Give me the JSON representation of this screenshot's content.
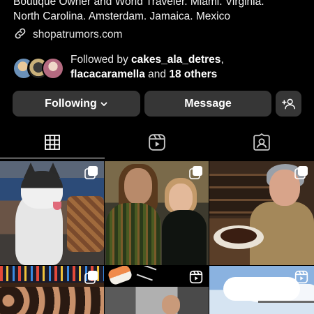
{
  "profile": {
    "bio_line1": "Boutique Owner and World Traveler. Miami. Virginia.",
    "bio_line2": "North Carolina. Amsterdam. Jamaica. Mexico",
    "link": "shopatrumors.com",
    "link_icon": "link-icon"
  },
  "followed_by": {
    "prefix": "Followed by ",
    "user1": "cakes_ala_detres",
    "comma": ",",
    "user2": "flacacaramella",
    "and": " and ",
    "others": "18 others"
  },
  "actions": {
    "following_label": "Following",
    "message_label": "Message",
    "add_person_icon": "add-person-icon"
  },
  "tabs": [
    {
      "name": "posts",
      "icon": "grid-icon",
      "active": true
    },
    {
      "name": "reels",
      "icon": "reels-icon",
      "active": false
    },
    {
      "name": "tagged",
      "icon": "tagged-icon",
      "active": false
    }
  ],
  "grid": [
    {
      "type": "carousel",
      "subject": "husky"
    },
    {
      "type": "carousel",
      "subject": "couple"
    },
    {
      "type": "carousel",
      "subject": "woman with cake"
    },
    {
      "type": "carousel",
      "subject": "party crowd"
    },
    {
      "type": "reel",
      "subject": "sushi"
    },
    {
      "type": "reel",
      "subject": "sky"
    }
  ],
  "colors": {
    "background": "#000000",
    "button": "#363636",
    "text": "#f5f5f5"
  }
}
